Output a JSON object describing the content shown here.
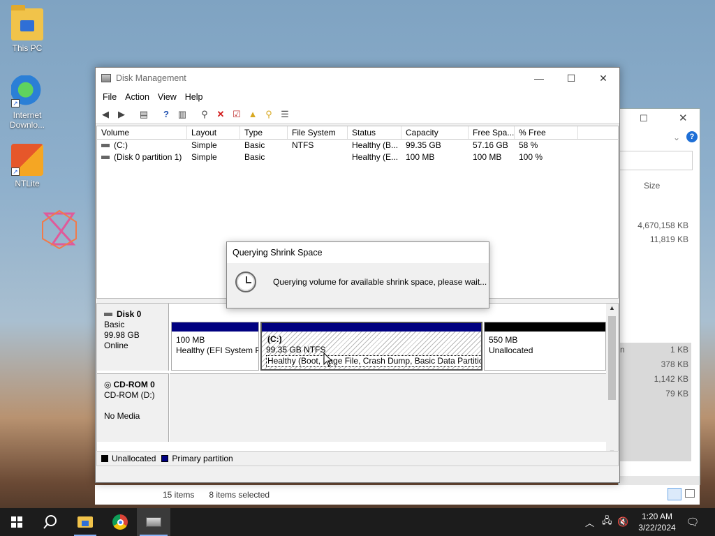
{
  "desktop": {
    "icons": [
      {
        "label": "This PC",
        "icon": "this-pc-icon"
      },
      {
        "label": "Internet Downlo...",
        "icon": "internet-download-manager-icon"
      },
      {
        "label": "NTLite",
        "icon": "ntlite-icon"
      }
    ]
  },
  "window": {
    "title": "Disk Management",
    "menu": [
      "File",
      "Action",
      "View",
      "Help"
    ],
    "columns": [
      "Volume",
      "Layout",
      "Type",
      "File System",
      "Status",
      "Capacity",
      "Free Spa...",
      "% Free"
    ],
    "rows": [
      [
        "(C:)",
        "Simple",
        "Basic",
        "NTFS",
        "Healthy (B...",
        "99.35 GB",
        "57.16 GB",
        "58 %"
      ],
      [
        "(Disk 0 partition 1)",
        "Simple",
        "Basic",
        "",
        "Healthy (E...",
        "100 MB",
        "100 MB",
        "100 %"
      ]
    ],
    "disk0": {
      "name": "Disk 0",
      "type": "Basic",
      "size": "99.98 GB",
      "state": "Online",
      "partitions": [
        {
          "line1": "",
          "line2": "100 MB",
          "line3": "Healthy (EFI System P"
        },
        {
          "line1": "(C:)",
          "line2": "99.35 GB NTFS",
          "line3": "Healthy (Boot, Page File, Crash Dump, Basic Data Partition)"
        },
        {
          "line1": "",
          "line2": "550 MB",
          "line3": "Unallocated"
        }
      ]
    },
    "cdrom": {
      "name": "CD-ROM 0",
      "drive": "CD-ROM (D:)",
      "media": "No Media"
    },
    "legend": {
      "unallocated": "Unallocated",
      "primary": "Primary partition"
    }
  },
  "dialog": {
    "title": "Querying Shrink Space",
    "message": "Querying volume for available shrink space, please wait..."
  },
  "background_window": {
    "column": "Size",
    "sizes_top": [
      "4,670,158 KB",
      "11,819 KB"
    ],
    "rows_frag": "n",
    "sizes_bottom": [
      "1 KB",
      "378 KB",
      "1,142 KB",
      "79 KB"
    ]
  },
  "explorer_status": {
    "items": "15 items",
    "selected": "8 items selected"
  },
  "taskbar": {
    "time": "1:20 AM",
    "date": "3/22/2024"
  },
  "colors": {
    "primary_partition": "#000080",
    "unallocated": "#000000",
    "taskbar": "#1c1c1c"
  }
}
